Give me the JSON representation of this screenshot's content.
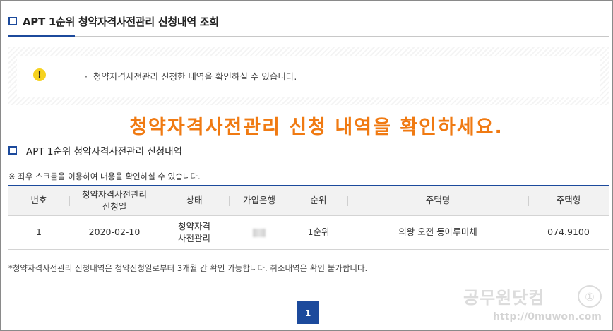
{
  "page": {
    "title": "APT 1순위 청약자격사전관리 신청내역 조회"
  },
  "notice": {
    "icon": "exclamation-icon",
    "bullet": "·",
    "text": "청약자격사전관리 신청한 내역을 확인하실 수 있습니다."
  },
  "banner": {
    "text": "청약자격사전관리 신청 내역을 확인하세요.",
    "color": "#f07a12"
  },
  "section": {
    "title": "APT 1순위 청약자격사전관리 신청내역",
    "scroll_note": "※ 좌우 스크롤을 이용하여 내용을 확인하실 수 있습니다."
  },
  "table": {
    "headers": [
      "번호",
      "청약자격사전관리\n신청일",
      "상태",
      "가입은행",
      "순위",
      "주택명",
      "주택형"
    ],
    "rows": [
      {
        "no": "1",
        "date": "2020-02-10",
        "status": "청약자격\n사전관리",
        "bank": "",
        "rank": "1순위",
        "house_name": "의왕 오전 동아루미체",
        "house_type": "074.9100"
      }
    ]
  },
  "footnote": "*청약자격사전관리 신청내역은 청약신청일로부터 3개월 간 확인 가능합니다. 취소내역은 확인 불가합니다.",
  "pagination": {
    "current": "1"
  },
  "watermark": {
    "logo": "①",
    "title": "공무원닷컴",
    "url": "http://0muwon.com"
  },
  "colors": {
    "accent": "#1c4a9c",
    "warning": "#f6d21f"
  }
}
